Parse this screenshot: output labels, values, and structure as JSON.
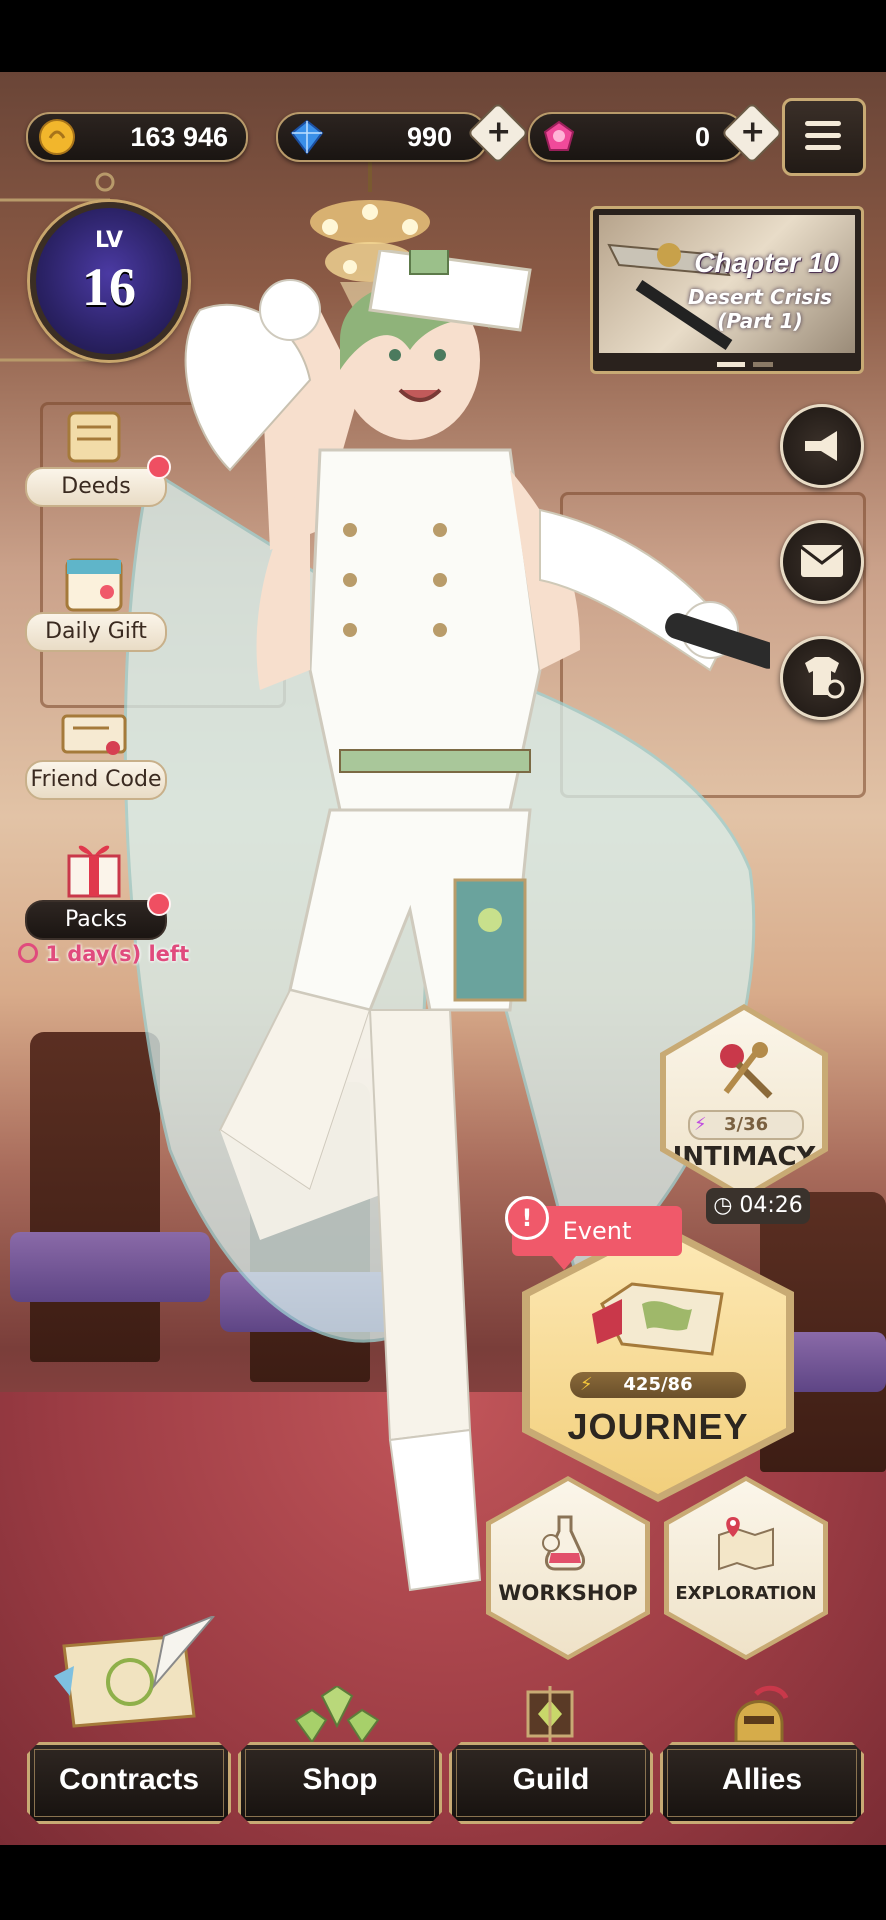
{
  "currency": {
    "gold": "163 946",
    "gems": "990",
    "hearts": "0",
    "gold_icon": "gold-coin-icon",
    "gem_icon": "blue-diamond-icon",
    "heart_icon": "pink-gem-icon",
    "plus": "+"
  },
  "player": {
    "level_prefix": "LV",
    "level": "16"
  },
  "side_menu": [
    {
      "label": "Deeds",
      "icon": "scroll-icon",
      "notify": true
    },
    {
      "label": "Daily Gift",
      "icon": "calendar-icon",
      "notify": false
    },
    {
      "label": "Friend Code",
      "icon": "ticket-icon",
      "notify": false
    },
    {
      "label": "Packs",
      "icon": "gift-box-icon",
      "notify": true
    }
  ],
  "packs_timer": "1 day(s) left",
  "chapter": {
    "title": "Chapter 10",
    "subtitle_line1": "Desert Crisis",
    "subtitle_line2": "(Part 1)"
  },
  "right_buttons": [
    "megaphone-icon",
    "mail-icon",
    "wardrobe-icon"
  ],
  "intimacy": {
    "label": "INTIMACY",
    "progress": "3/36",
    "timer": "04:26"
  },
  "journey": {
    "label": "JOURNEY",
    "progress": "425/86",
    "tag": "Event",
    "alert": "!"
  },
  "workshop": {
    "label": "WORKSHOP"
  },
  "exploration": {
    "label": "EXPLORATION"
  },
  "bottom_nav": [
    {
      "label": "Contracts"
    },
    {
      "label": "Shop"
    },
    {
      "label": "Guild"
    },
    {
      "label": "Allies"
    }
  ],
  "colors": {
    "accent_gold": "#c8aa74",
    "notify_red": "#ef4f62",
    "event_pink": "#f0596a",
    "lightning_purple": "#c04ce0"
  }
}
